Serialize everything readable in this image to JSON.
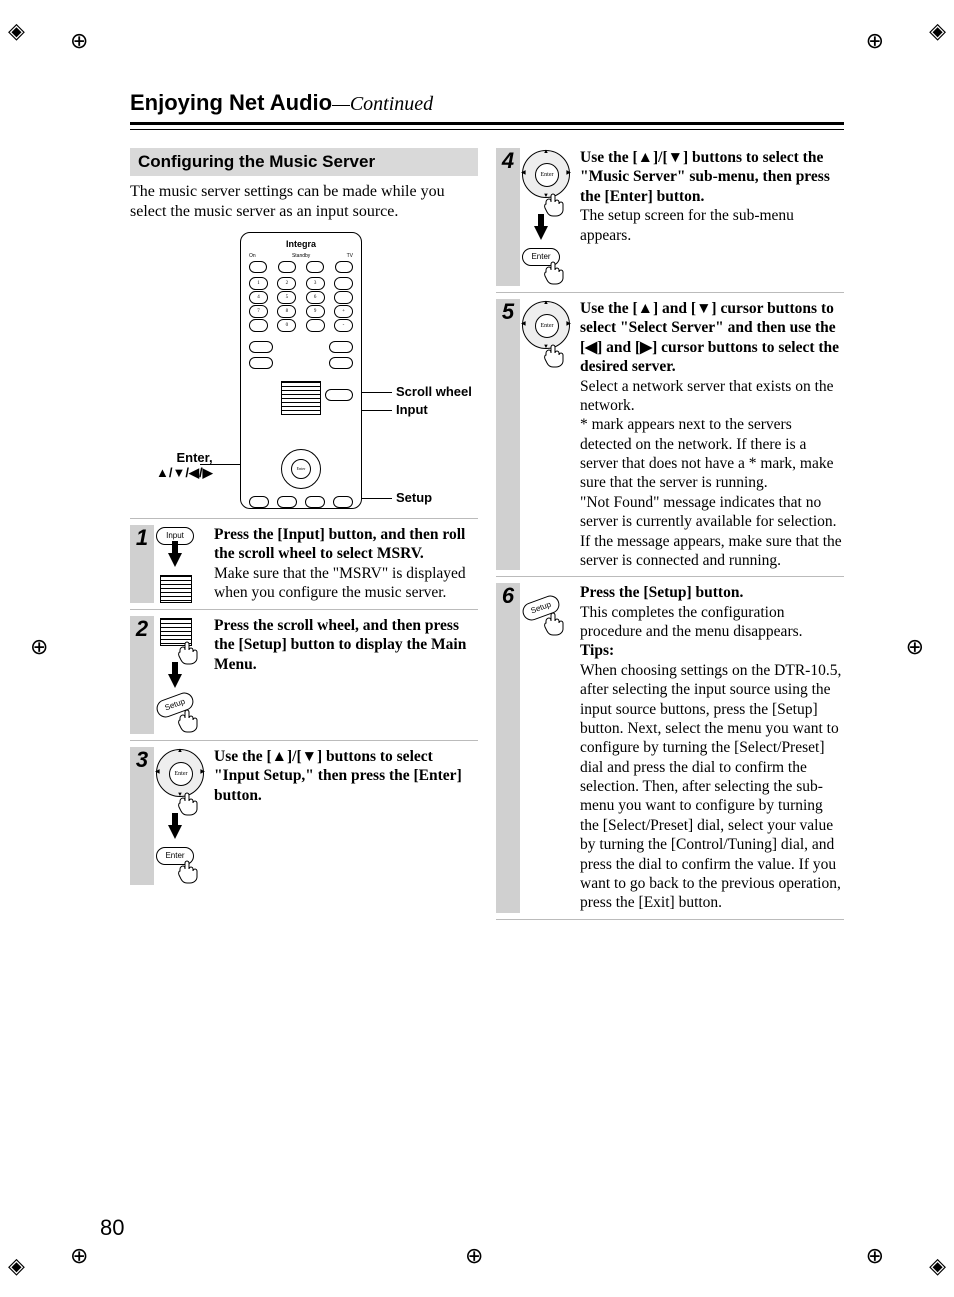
{
  "page_number": "80",
  "header": {
    "title": "Enjoying Net Audio",
    "continued": "—Continued"
  },
  "section_heading": "Configuring the Music Server",
  "intro": "The music server settings can be made while you select the music server as an input source.",
  "remote": {
    "brand": "Integra",
    "labels": {
      "on": "On",
      "standby": "Standby",
      "tv": "TV"
    },
    "callouts": {
      "scroll_wheel": "Scroll wheel",
      "input": "Input",
      "setup": "Setup",
      "enter": "Enter,",
      "arrows": "▲/▼/◀/▶"
    }
  },
  "steps_left": [
    {
      "num": "1",
      "icon_label": "Input",
      "bold": "Press the [Input] button, and then roll the scroll wheel to select MSRV.",
      "body": "Make sure that the \"MSRV\" is displayed when you configure the music server."
    },
    {
      "num": "2",
      "icon_label": "Setup",
      "bold": "Press the scroll wheel, and then press the [Setup] button to display the Main Menu.",
      "body": ""
    },
    {
      "num": "3",
      "icon_label": "Enter",
      "bold": "Use the [▲]/[▼] buttons to select \"Input Setup,\" then press the [Enter] button.",
      "body": ""
    }
  ],
  "steps_right": [
    {
      "num": "4",
      "icon_label": "Enter",
      "bold": "Use the [▲]/[▼] buttons to select the \"Music Server\" sub-menu, then press the [Enter] button.",
      "body": "The setup screen for the sub-menu appears."
    },
    {
      "num": "5",
      "icon_label": "Enter",
      "bold": "Use the [▲] and [▼] cursor buttons to select \"Select Server\" and then use the [◀] and [▶] cursor buttons to select the desired server.",
      "body": "Select a network server that exists on the network.\n* mark appears next to the servers detected on the network. If there is a server that does not have a * mark, make sure that the server is running.\n\"Not Found\" message indicates that no server is currently available for selection. If the message appears, make sure that the server is connected and running."
    },
    {
      "num": "6",
      "icon_label": "Setup",
      "bold": "Press the [Setup] button.",
      "body": "This completes the configuration procedure and the menu disappears.",
      "tips_label": "Tips:",
      "tips": "When choosing settings on the DTR-10.5, after selecting the input source using the input source buttons, press the [Setup] button. Next, select the menu you want to configure by turning the [Select/Preset] dial and press the dial to confirm the selection. Then, after selecting the sub-menu you want to configure by turning the [Select/Preset] dial, select your value by turning the [Control/Tuning] dial, and press the dial to confirm the value. If you want to go back to the previous operation, press the [Exit] button."
    }
  ]
}
